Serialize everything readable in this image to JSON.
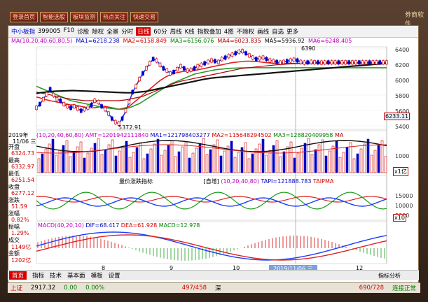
{
  "topbar": {
    "buttons": [
      "登录首页",
      "智能选股",
      "板块监测",
      "热点关注",
      "快速交易"
    ],
    "logo": "券商软件"
  },
  "toolbar": {
    "stock": "中小板指",
    "code": "399005",
    "items": [
      "F10",
      "诊股",
      "除权",
      "全景",
      "分时",
      "日线",
      "60分",
      "周线",
      "K线",
      "指数叠加",
      "4图",
      "不除权",
      "画线",
      "自选",
      "更多"
    ],
    "selected": "日线"
  },
  "ma_bar": {
    "params": "MA(10,20,40,60,80,5)",
    "ma1": "MA1=6218.238",
    "ma2": "MA2=6158.849",
    "ma3": "MA3=6156.076",
    "ma4": "MA4=6023.835",
    "ma5": "MA5=5936.92",
    "ma6": "MA6=6248.405"
  },
  "price_axis": [
    "6400",
    "6200",
    "6000",
    "5800",
    "5600",
    "5400"
  ],
  "price_marks": {
    "high": "6390",
    "low": "5372.91",
    "current": "6233.11",
    "date_tip": "2019年",
    "date_tip2": "11/06 三"
  },
  "left_info": [
    "开盘",
    "6324.73",
    "最高",
    "6332.97",
    "最低",
    "6251.54",
    "收盘",
    "6277.12",
    "涨跌",
    "51.59",
    "涨幅",
    "0.82%",
    "振幅",
    "1.29%",
    "成交",
    "1149亿",
    "金额",
    "1202亿"
  ],
  "vol_bar": {
    "params": "(10,20,40,60,80)",
    "amt": "AMT=1201942111840",
    "ma1": "MA1=121798403277",
    "ma2": "MA2=115648294502",
    "ma3": "MA3=128820409958",
    "ma4": "MA"
  },
  "vol_axis": [
    "1000"
  ],
  "vol_unit": "x1亿",
  "taipm_bar": {
    "title": "量价涨跌指标",
    "tab": "[自增]",
    "params": "(10,20,40,80)",
    "tapi": "TAPI=121888.783",
    "taipma": "TAIPMA"
  },
  "taipm_axis": [
    "15000",
    "10000",
    "5000"
  ],
  "taipm_unit": "x10",
  "macd_bar": {
    "params": "MACD(40,20,10)",
    "dif": "DIF=68.417",
    "dea": "DEA=61.928",
    "macd": "MACD=12.978"
  },
  "x_axis": [
    "8",
    "9",
    "10",
    "2019/11/06 三",
    "12"
  ],
  "bottom_tabs": [
    "首页",
    "指标",
    "技术",
    "基本面",
    "模板",
    "设置"
  ],
  "bottom_right": "指标分析",
  "status": {
    "a": "上证",
    "a_val": "2917.32",
    "a_chg": "0.00",
    "a_pct": "0.00%",
    "mid": "497/458",
    "mid_label": "深",
    "right": "690/728",
    "conn": "连接正常"
  },
  "colors": {
    "up": "#d40000",
    "down": "#0000c8",
    "ma_blue": "#1a3cff",
    "ma_red": "#e02020",
    "ma_green": "#2a9a2a",
    "ma_black": "#111111"
  },
  "chart_data": {
    "type": "line",
    "x": [
      0,
      5,
      10,
      15,
      20,
      25,
      30,
      35,
      40,
      45,
      50,
      55,
      60,
      65,
      70,
      75,
      80,
      85,
      90,
      95,
      100,
      105,
      110,
      115,
      120,
      125,
      130,
      135,
      140,
      145,
      150,
      155,
      160,
      165,
      170,
      175,
      180,
      185,
      190,
      195,
      200,
      205,
      210,
      215,
      220,
      225,
      230,
      235,
      240,
      245,
      250,
      255,
      260,
      265,
      270,
      275,
      280,
      285,
      290,
      295,
      300,
      305,
      310,
      315,
      320,
      325,
      330,
      335,
      340,
      345,
      350,
      355,
      360,
      365,
      370,
      375,
      380,
      385,
      390,
      395,
      400,
      405,
      410,
      415,
      420,
      425,
      430,
      435,
      440,
      445,
      450,
      455,
      460,
      465,
      470,
      475,
      480,
      485,
      490,
      495,
      500,
      505,
      510
    ],
    "series": [
      {
        "values": [
          5600,
          5650,
          5720,
          5790,
          5860,
          5780,
          5720,
          5700,
          5650,
          5620,
          5600,
          5620,
          5590,
          5560,
          5580,
          5600,
          5640,
          5700,
          5680,
          5620,
          5580,
          5520,
          5450,
          5400,
          5380,
          5450,
          5560,
          5680,
          5820,
          5900,
          6000,
          6080,
          6150,
          6220,
          6280,
          6260,
          6200,
          6150,
          6120,
          6080,
          6100,
          6140,
          6180,
          6150,
          6120,
          6130,
          6150,
          6180,
          6200,
          6220,
          6240,
          6260,
          6250,
          6240,
          6280,
          6300,
          6320,
          6340,
          6360,
          6380,
          6390,
          6360,
          6330,
          6300,
          6280,
          6290,
          6300,
          6280,
          6260,
          6250,
          6240,
          6230,
          6240,
          6250,
          6260,
          6270,
          6260,
          6240,
          6230,
          6233,
          6240,
          6235,
          6233,
          6230,
          6232,
          6233,
          6233,
          6233,
          6233,
          6233,
          6233,
          6233,
          6233,
          6233,
          6233,
          6233,
          6233,
          6233,
          6233,
          6233,
          6233,
          6233,
          6233
        ]
      },
      {
        "values": [
          5750,
          5740,
          5720,
          5710,
          5700,
          5690,
          5680,
          5670,
          5660,
          5650,
          5640,
          5640,
          5630,
          5620,
          5610,
          5600,
          5600,
          5600,
          5610,
          5620,
          5620,
          5610,
          5600,
          5590,
          5580,
          5590,
          5600,
          5620,
          5660,
          5700,
          5740,
          5780,
          5820,
          5860,
          5900,
          5940,
          5980,
          6010,
          6040,
          6060,
          6080,
          6090,
          6100,
          6110,
          6110,
          6115,
          6120,
          6130,
          6140,
          6150,
          6160,
          6170,
          6180,
          6190,
          6200,
          6210,
          6220,
          6230,
          6235,
          6240,
          6245,
          6250,
          6250,
          6248,
          6245,
          6240,
          6235,
          6230,
          6225,
          6222,
          6220,
          6218,
          6218,
          6218,
          6218,
          6218,
          6218,
          6218,
          6218,
          6218,
          6218,
          6218,
          6218,
          6218,
          6218,
          6218,
          6218,
          6218,
          6218,
          6218,
          6218,
          6218,
          6218,
          6218,
          6218,
          6218,
          6218,
          6218,
          6218,
          6218,
          6218,
          6218,
          6218
        ]
      },
      {
        "values": [
          5900,
          5880,
          5860,
          5840,
          5820,
          5800,
          5780,
          5760,
          5740,
          5720,
          5700,
          5690,
          5680,
          5670,
          5660,
          5650,
          5640,
          5630,
          5620,
          5610,
          5600,
          5595,
          5590,
          5585,
          5580,
          5580,
          5590,
          5600,
          5620,
          5640,
          5660,
          5690,
          5720,
          5750,
          5780,
          5810,
          5840,
          5870,
          5900,
          5930,
          5950,
          5970,
          5990,
          6010,
          6030,
          6050,
          6070,
          6080,
          6090,
          6100,
          6110,
          6120,
          6130,
          6135,
          6140,
          6145,
          6150,
          6152,
          6154,
          6156,
          6158,
          6159,
          6160,
          6160,
          6160,
          6160,
          6159,
          6159,
          6159,
          6159,
          6159,
          6159,
          6159,
          6159,
          6159,
          6159,
          6159,
          6159,
          6159,
          6159,
          6159,
          6159,
          6159,
          6159,
          6159,
          6159,
          6159,
          6159,
          6159,
          6159,
          6159,
          6159,
          6159,
          6159,
          6159,
          6159,
          6159,
          6159,
          6159,
          6159,
          6159,
          6159,
          6159
        ]
      },
      {
        "values": [
          5820,
          5810,
          5800,
          5790,
          5780,
          5770,
          5760,
          5750,
          5740,
          5730,
          5720,
          5715,
          5710,
          5705,
          5700,
          5700,
          5700,
          5700,
          5700,
          5700,
          5700,
          5700,
          5700,
          5700,
          5700,
          5705,
          5710,
          5720,
          5730,
          5740,
          5750,
          5760,
          5780,
          5800,
          5820,
          5840,
          5860,
          5880,
          5900,
          5920,
          5940,
          5955,
          5970,
          5980,
          5990,
          6000,
          6010,
          6020,
          6030,
          6040,
          6050,
          6060,
          6070,
          6080,
          6090,
          6100,
          6110,
          6120,
          6130,
          6140,
          6150,
          6155,
          6160,
          6165,
          6170,
          6175,
          6180,
          6185,
          6190,
          6195,
          6200,
          6203,
          6206,
          6209,
          6212,
          6215,
          6218,
          6220,
          6222,
          6224,
          6226,
          6228,
          6229,
          6230,
          6231,
          6232,
          6232,
          6232,
          6232,
          6232,
          6232,
          6232,
          6232,
          6232,
          6232,
          6232,
          6232,
          6232,
          6232,
          6232,
          6232,
          6232,
          6232
        ]
      },
      {
        "values": [
          5800,
          5810,
          5815,
          5820,
          5825,
          5830,
          5832,
          5834,
          5836,
          5838,
          5840,
          5840,
          5838,
          5836,
          5834,
          5832,
          5830,
          5828,
          5826,
          5824,
          5822,
          5820,
          5818,
          5816,
          5814,
          5812,
          5810,
          5810,
          5812,
          5815,
          5820,
          5825,
          5830,
          5840,
          5850,
          5860,
          5870,
          5880,
          5890,
          5900,
          5910,
          5920,
          5930,
          5940,
          5950,
          5960,
          5970,
          5980,
          5990,
          6000,
          6008,
          6014,
          6020,
          6024,
          6028,
          6032,
          6036,
          6040,
          6044,
          6048,
          6052,
          6056,
          6060,
          6064,
          6068,
          6072,
          6076,
          6080,
          6084,
          6088,
          6092,
          6096,
          6100,
          6104,
          6108,
          6112,
          6116,
          6120,
          6124,
          6128,
          6132,
          6136,
          6140,
          6144,
          6148,
          6152,
          6156,
          6160,
          6164,
          6168,
          6172,
          6176,
          6180,
          6184,
          6188,
          6192,
          6196,
          6200,
          6204,
          6208,
          6212,
          6216,
          6220
        ]
      }
    ],
    "ylim": [
      5300,
      6450
    ]
  }
}
